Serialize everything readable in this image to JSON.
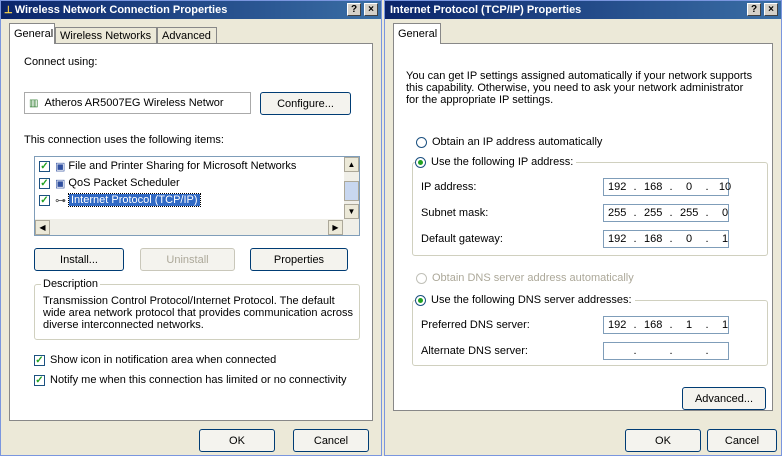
{
  "window1": {
    "title": "Wireless Network Connection Properties",
    "help_button": "?",
    "close_button": "×",
    "tabs": [
      {
        "label": "General"
      },
      {
        "label": "Wireless Networks"
      },
      {
        "label": "Advanced"
      }
    ],
    "connect_using_label": "Connect using:",
    "adapter_name": "Atheros AR5007EG Wireless Networ",
    "configure_button": "Configure...",
    "items_label": "This connection uses the following items:",
    "items": [
      {
        "label": "File and Printer Sharing for Microsoft Networks",
        "checked": true
      },
      {
        "label": "QoS Packet Scheduler",
        "checked": true
      },
      {
        "label": "Internet Protocol (TCP/IP)",
        "checked": true,
        "selected": true
      }
    ],
    "install_button": "Install...",
    "uninstall_button": "Uninstall",
    "properties_button": "Properties",
    "description_title": "Description",
    "description_text": "Transmission Control Protocol/Internet Protocol. The default wide area network protocol that provides communication across diverse interconnected networks.",
    "show_icon_label": "Show icon in notification area when connected",
    "notify_label": "Notify me when this connection has limited or no connectivity",
    "ok_button": "OK",
    "cancel_button": "Cancel"
  },
  "window2": {
    "title": "Internet Protocol (TCP/IP) Properties",
    "help_button": "?",
    "close_button": "×",
    "tab_label": "General",
    "intro_text": "You can get IP settings assigned automatically if your network supports this capability. Otherwise, you need to ask your network administrator for the appropriate IP settings.",
    "obtain_ip_auto": "Obtain an IP address automatically",
    "use_following_ip": "Use the following IP address:",
    "ip_address_label": "IP address:",
    "ip_address": [
      "192",
      "168",
      "0",
      "10"
    ],
    "subnet_mask_label": "Subnet mask:",
    "subnet_mask": [
      "255",
      "255",
      "255",
      "0"
    ],
    "default_gateway_label": "Default gateway:",
    "default_gateway": [
      "192",
      "168",
      "0",
      "1"
    ],
    "obtain_dns_auto": "Obtain DNS server address automatically",
    "use_following_dns": "Use the following DNS server addresses:",
    "preferred_dns_label": "Preferred DNS server:",
    "preferred_dns": [
      "192",
      "168",
      "1",
      "1"
    ],
    "alternate_dns_label": "Alternate DNS server:",
    "alternate_dns": [
      "",
      "",
      "",
      ""
    ],
    "dot": ".",
    "advanced_button": "Advanced...",
    "ok_button": "OK",
    "cancel_button": "Cancel"
  }
}
